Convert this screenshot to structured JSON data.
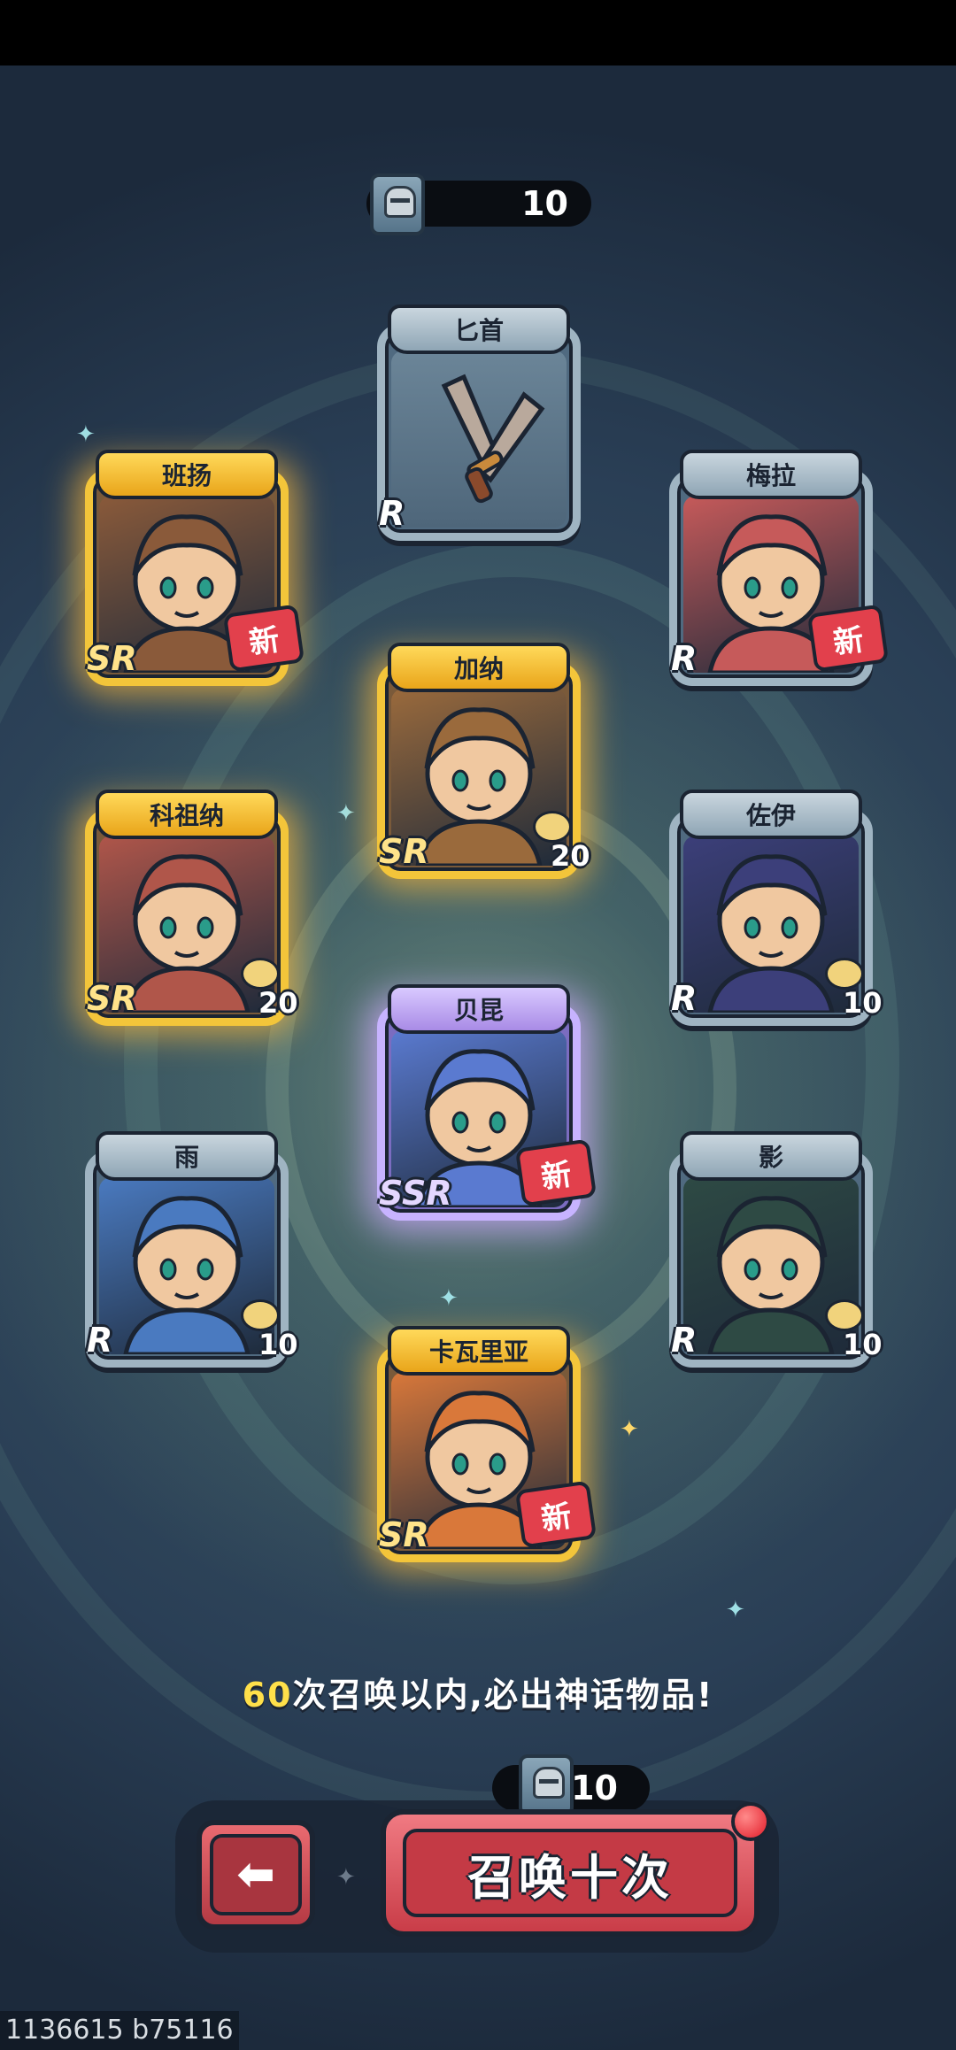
{
  "top_counter": {
    "value": "10",
    "icon": "helmet-ticket-icon"
  },
  "cards": [
    {
      "id": "dagger",
      "name": "匕首",
      "rarity": "R",
      "badge": "",
      "count": "",
      "theme": "#6e8aa0",
      "art": "dagger"
    },
    {
      "id": "banyang",
      "name": "班扬",
      "rarity": "SR",
      "badge": "新",
      "count": "",
      "theme": "#8a5a3a",
      "art": "hero"
    },
    {
      "id": "meila",
      "name": "梅拉",
      "rarity": "R",
      "badge": "新",
      "count": "",
      "theme": "#c65a5a",
      "art": "hero"
    },
    {
      "id": "jiana",
      "name": "加纳",
      "rarity": "SR",
      "badge": "",
      "count": "20",
      "theme": "#9a6a3c",
      "art": "hero"
    },
    {
      "id": "kezuna",
      "name": "科祖纳",
      "rarity": "SR",
      "badge": "",
      "count": "20",
      "theme": "#b0564a",
      "art": "hero"
    },
    {
      "id": "zuoyi",
      "name": "佐伊",
      "rarity": "R",
      "badge": "",
      "count": "10",
      "theme": "#3c3f7a",
      "art": "hero"
    },
    {
      "id": "beikun",
      "name": "贝昆",
      "rarity": "SSR",
      "badge": "新",
      "count": "",
      "theme": "#5a7ad0",
      "art": "hero"
    },
    {
      "id": "yu",
      "name": "雨",
      "rarity": "R",
      "badge": "",
      "count": "10",
      "theme": "#4a7ac0",
      "art": "hero"
    },
    {
      "id": "ying",
      "name": "影",
      "rarity": "R",
      "badge": "",
      "count": "10",
      "theme": "#2e4a44",
      "art": "hero"
    },
    {
      "id": "kawaliya",
      "name": "卡瓦里亚",
      "rarity": "SR",
      "badge": "新",
      "count": "",
      "theme": "#d9783a",
      "art": "hero"
    }
  ],
  "promo": {
    "number": "60",
    "text": "次召唤以内,必出神话物品!"
  },
  "bottom_counter": {
    "value": "10",
    "icon": "helmet-ticket-icon"
  },
  "buttons": {
    "back_icon": "back-arrow-icon",
    "summon_label": "召唤十次"
  },
  "version_text": "1136615 b75116",
  "colors": {
    "sr_gold": "#f3c53a",
    "ssr_purple": "#c7b3ff",
    "r_silver": "#9fb4c2",
    "summon_red": "#c93d48"
  }
}
